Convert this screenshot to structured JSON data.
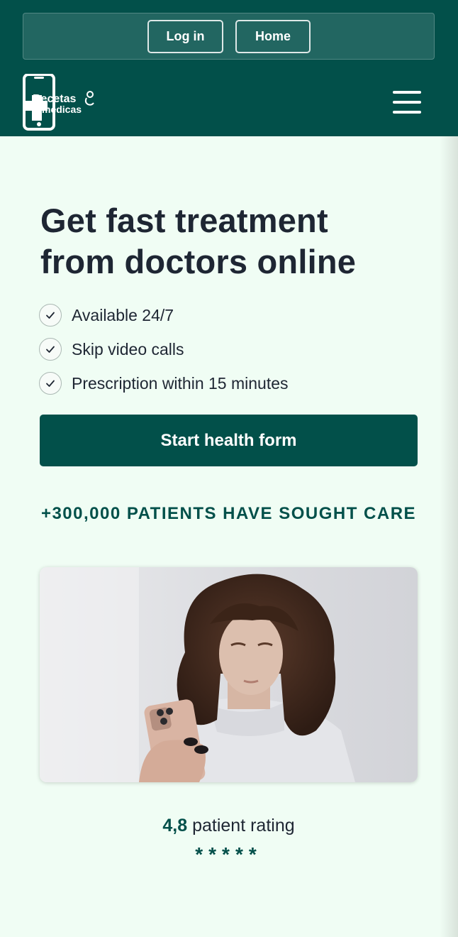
{
  "header": {
    "login_label": "Log in",
    "home_label": "Home",
    "logo_line1": "Recetas",
    "logo_line2": "médicas",
    "brand_color": "#02504a"
  },
  "hero": {
    "title": "Get fast treatment from doctors online",
    "features": [
      {
        "label": "Available 24/7",
        "icon": "check-icon"
      },
      {
        "label": "Skip video calls",
        "icon": "check-icon"
      },
      {
        "label": "Prescription within 15 minutes",
        "icon": "check-icon"
      }
    ],
    "cta_label": "Start health form"
  },
  "social_proof": {
    "patients_text": "+300,000 PATIENTS HAVE SOUGHT CARE",
    "rating_value": "4,8",
    "rating_label": "patient rating",
    "stars": "*****",
    "star_count": 5
  },
  "colors": {
    "background": "#f0fdf4",
    "text": "#1e2633",
    "accent": "#02504a"
  }
}
